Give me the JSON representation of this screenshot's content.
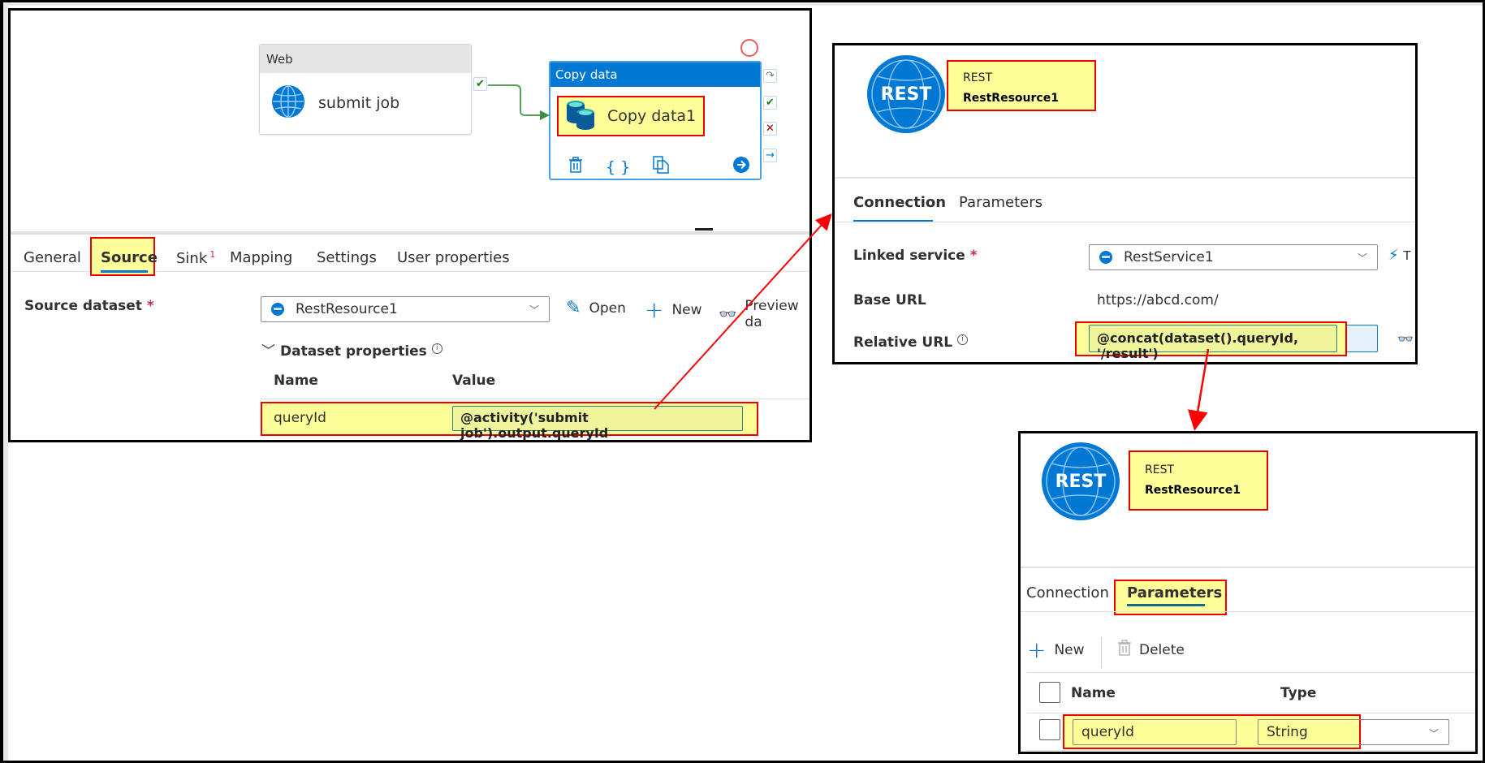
{
  "pipeline": {
    "web_activity": {
      "type_label": "Web",
      "name": "submit job",
      "icon": "globe-icon"
    },
    "copy_activity": {
      "type_label": "Copy data",
      "name": "Copy data1",
      "icon": "database-icon",
      "tools": [
        "delete-icon",
        "code-icon",
        "clone-icon",
        "go-icon"
      ],
      "connectors": [
        "skip-icon",
        "success-icon",
        "failure-icon",
        "completion-icon"
      ]
    },
    "success_link": "success-check-icon"
  },
  "activity_tabs": [
    {
      "label": "General",
      "active": false
    },
    {
      "label": "Source",
      "active": true
    },
    {
      "label": "Sink",
      "active": false,
      "badge": "1"
    },
    {
      "label": "Mapping",
      "active": false
    },
    {
      "label": "Settings",
      "active": false
    },
    {
      "label": "User properties",
      "active": false
    }
  ],
  "source": {
    "dataset_label": "Source dataset",
    "required_mark": "*",
    "dataset_value": "RestResource1",
    "actions": {
      "open": "Open",
      "new": "New",
      "preview": "Preview da"
    },
    "dataset_properties_label": "Dataset properties",
    "columns": {
      "name": "Name",
      "value": "Value"
    },
    "rows": [
      {
        "name": "queryId",
        "value": "@activity('submit job').output.queryId"
      }
    ]
  },
  "rest_dataset": {
    "logo_text": "REST",
    "type": "REST",
    "name": "RestResource1",
    "tabs": [
      {
        "label": "Connection",
        "active": true
      },
      {
        "label": "Parameters",
        "active": false
      }
    ],
    "linked_service_label": "Linked service",
    "required_mark": "*",
    "linked_service_value": "RestService1",
    "test_connection_label": "T",
    "base_url_label": "Base URL",
    "base_url_value": "https://abcd.com/",
    "relative_url_label": "Relative URL",
    "relative_url_value": "@concat(dataset().queryId, '/result')"
  },
  "rest_params": {
    "logo_text": "REST",
    "type": "REST",
    "name": "RestResource1",
    "tabs": [
      {
        "label": "Connection",
        "active": false
      },
      {
        "label": "Parameters",
        "active": true
      }
    ],
    "actions": {
      "new": "New",
      "delete": "Delete"
    },
    "columns": {
      "name": "Name",
      "type": "Type"
    },
    "rows": [
      {
        "name": "queryId",
        "type": "String"
      }
    ]
  },
  "colors": {
    "accent": "#0078d4",
    "highlight": "#ffff99",
    "highlight_border": "#e00000",
    "expression_bg": "#eef59a",
    "success": "#107c10",
    "failure": "#a80000"
  }
}
